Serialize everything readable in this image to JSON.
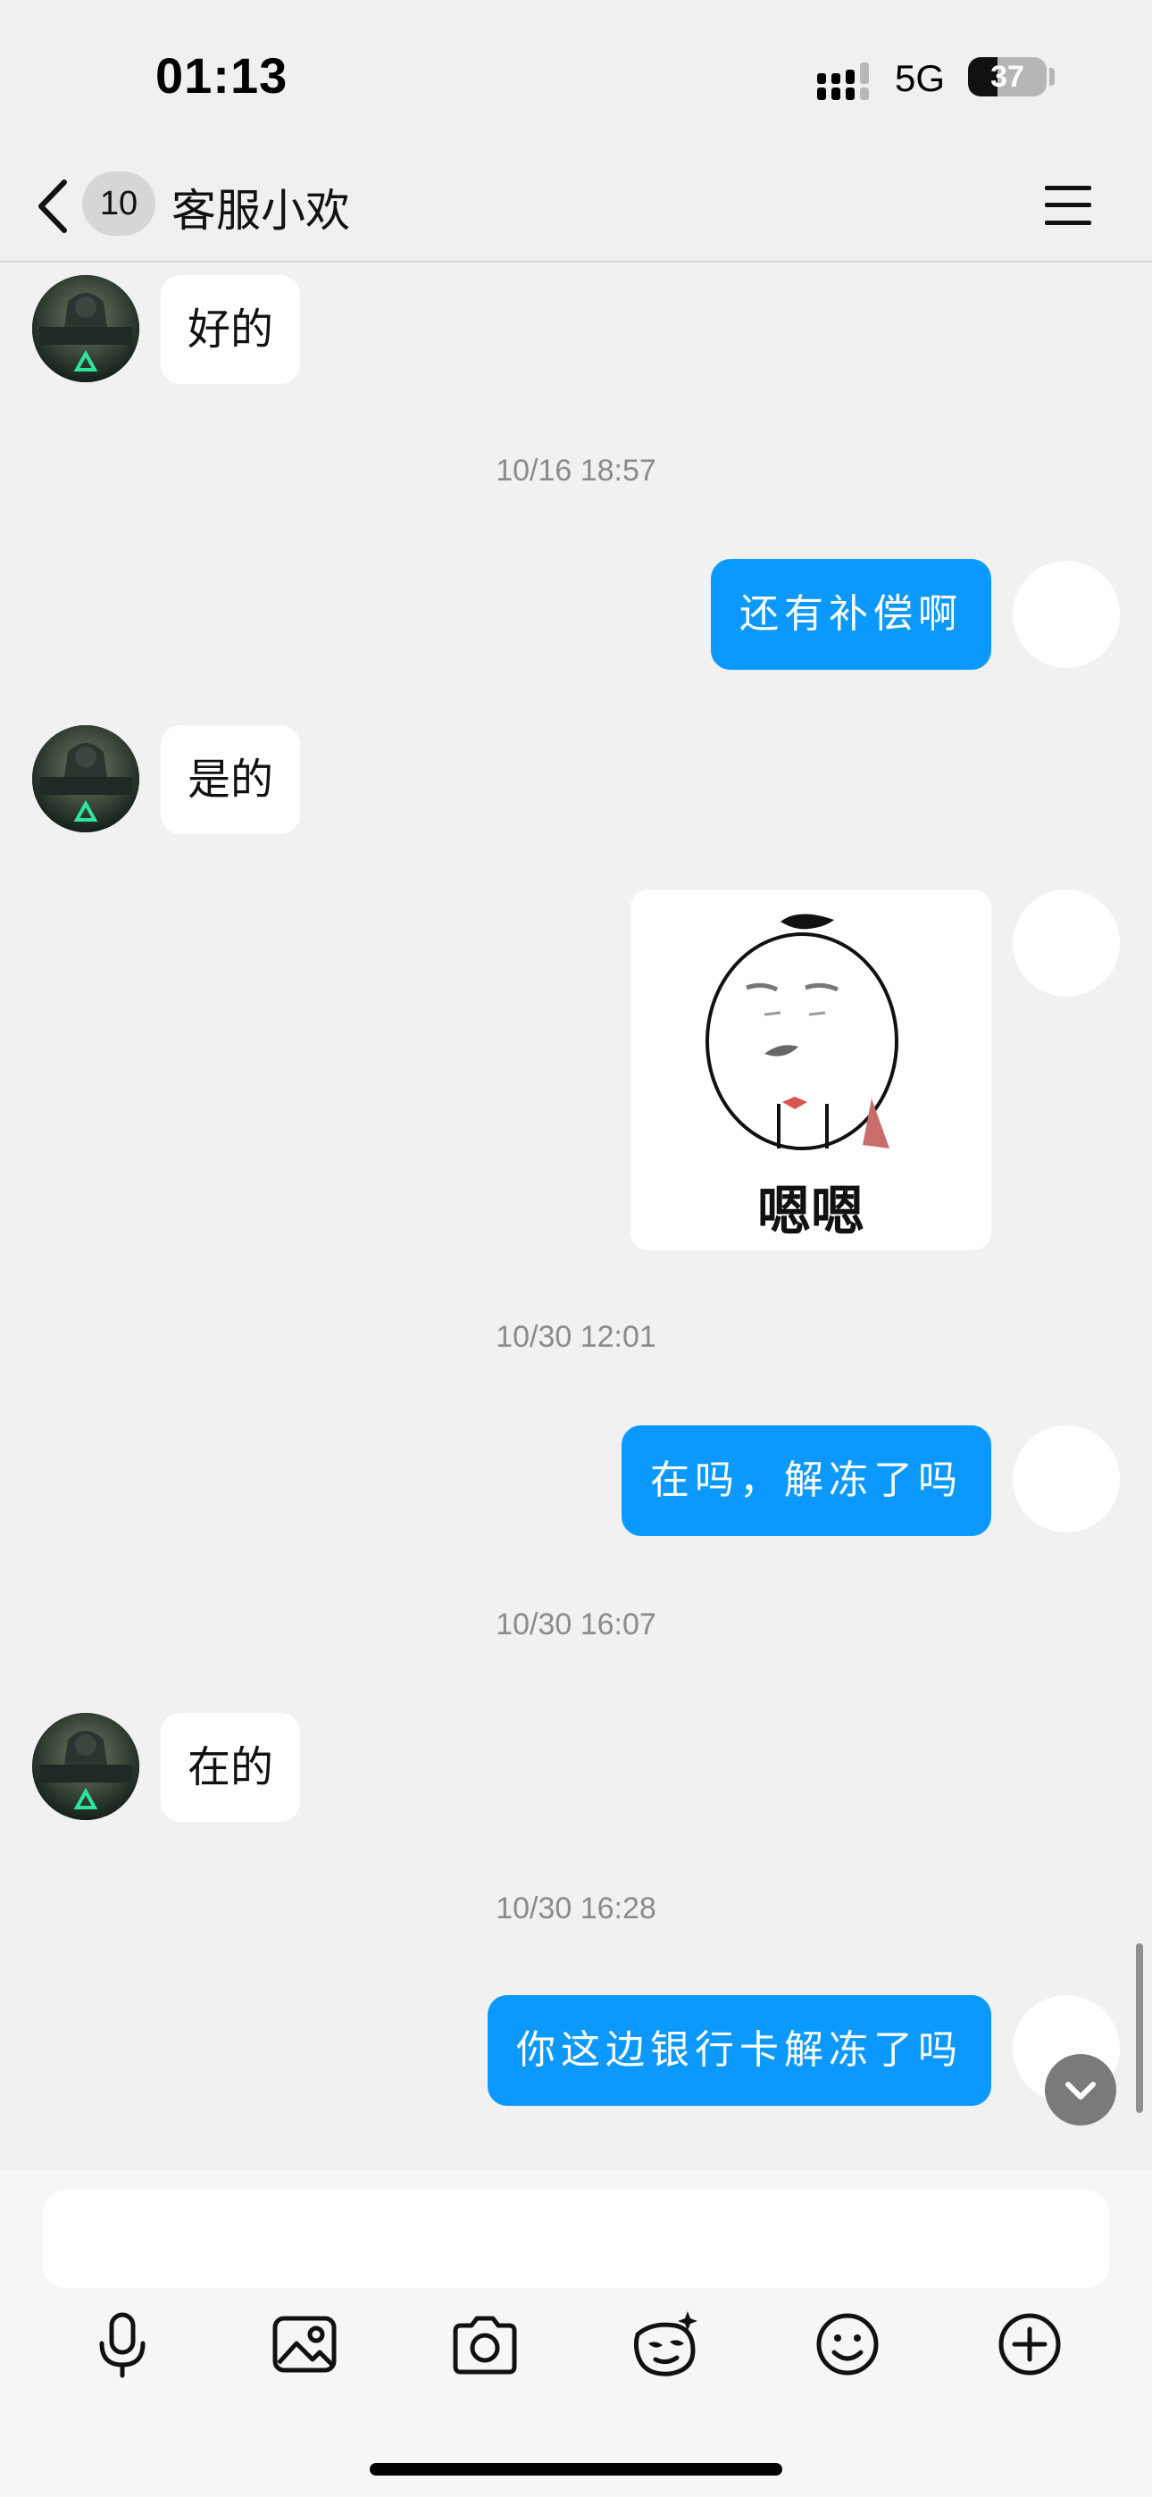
{
  "status_bar": {
    "time": "01:13",
    "network": "5G",
    "battery": "37",
    "battery_level": 0.37
  },
  "header": {
    "unread_count": "10",
    "title": "客服小欢"
  },
  "messages": [
    {
      "type": "text_left",
      "text": "好的"
    },
    {
      "type": "timestamp",
      "text": "10/16 18:57"
    },
    {
      "type": "text_right",
      "text": "还有补偿啊"
    },
    {
      "type": "text_left",
      "text": "是的"
    },
    {
      "type": "sticker_right",
      "text": "嗯嗯"
    },
    {
      "type": "timestamp",
      "text": "10/30 12:01"
    },
    {
      "type": "text_right",
      "text": "在吗，解冻了吗"
    },
    {
      "type": "timestamp",
      "text": "10/30 16:07"
    },
    {
      "type": "text_left",
      "text": "在的"
    },
    {
      "type": "timestamp",
      "text": "10/30 16:28"
    },
    {
      "type": "text_right",
      "text": "你这边银行卡解冻了吗"
    }
  ],
  "avatar_logo_text": "三角洲行动",
  "colors": {
    "sent_bubble": "#0b99ff",
    "received_bubble": "#ffffff",
    "background": "#f1f1f1"
  },
  "toolbar": {
    "icons": [
      "microphone-icon",
      "image-icon",
      "camera-icon",
      "sticker-face-icon",
      "emoji-icon",
      "plus-icon"
    ]
  }
}
